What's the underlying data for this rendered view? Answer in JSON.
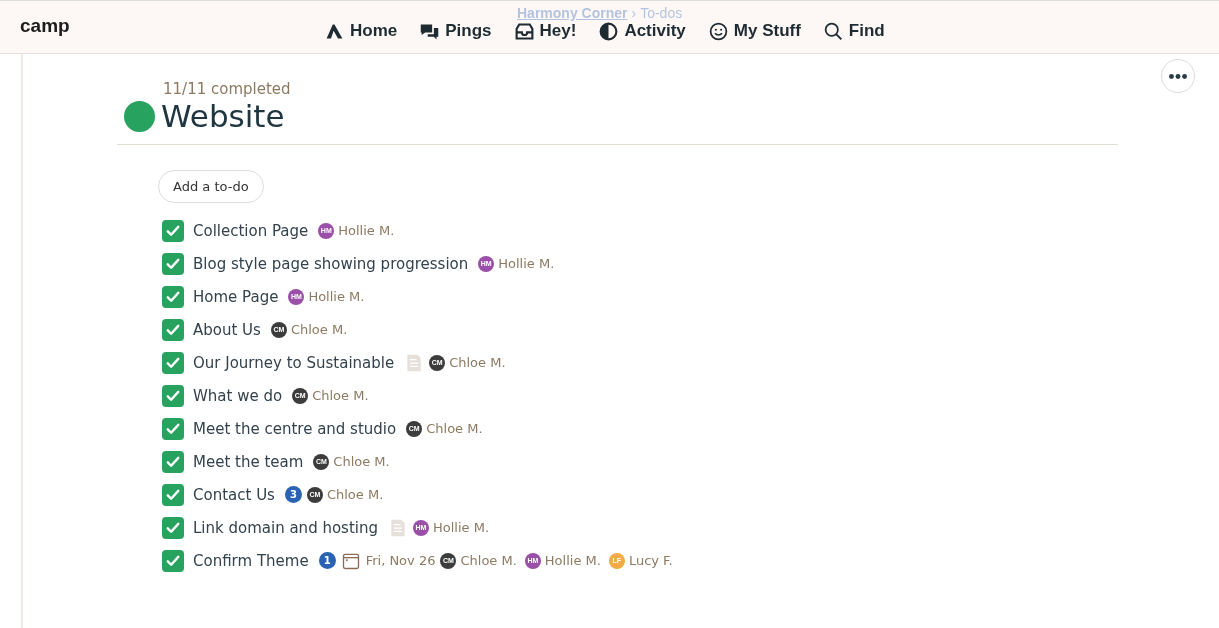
{
  "header": {
    "brand": "camp",
    "breadcrumb": {
      "project": "Harmony Corner",
      "separator": "›",
      "section": "To-dos"
    },
    "nav": [
      {
        "kind": "home",
        "label": "Home"
      },
      {
        "kind": "pings",
        "label": "Pings"
      },
      {
        "kind": "hey",
        "label": "Hey!"
      },
      {
        "kind": "activity",
        "label": "Activity"
      },
      {
        "kind": "stuff",
        "label": "My Stuff"
      },
      {
        "kind": "find",
        "label": "Find"
      }
    ]
  },
  "list": {
    "progress": "11/11 completed",
    "title": "Website",
    "add_button": "Add a to-do",
    "todos": [
      {
        "title": "Collection Page",
        "checked": true,
        "meta": [
          {
            "kind": "assignee",
            "initials": "HM",
            "name": "Hollie M.",
            "color": "#9a50a9"
          }
        ]
      },
      {
        "title": "Blog style page showing progression",
        "checked": true,
        "meta": [
          {
            "kind": "assignee",
            "initials": "HM",
            "name": "Hollie M.",
            "color": "#9a50a9"
          }
        ]
      },
      {
        "title": "Home Page",
        "checked": true,
        "meta": [
          {
            "kind": "assignee",
            "initials": "HM",
            "name": "Hollie M.",
            "color": "#9a50a9"
          }
        ]
      },
      {
        "title": "About Us",
        "checked": true,
        "meta": [
          {
            "kind": "assignee",
            "initials": "CM",
            "name": "Chloe M.",
            "color": "#3c3c3c"
          }
        ]
      },
      {
        "title": "Our Journey to Sustainable",
        "checked": true,
        "meta": [
          {
            "kind": "note"
          },
          {
            "kind": "assignee",
            "initials": "CM",
            "name": "Chloe M.",
            "color": "#3c3c3c"
          }
        ]
      },
      {
        "title": "What we do",
        "checked": true,
        "meta": [
          {
            "kind": "assignee",
            "initials": "CM",
            "name": "Chloe M.",
            "color": "#3c3c3c"
          }
        ]
      },
      {
        "title": "Meet the centre and studio",
        "checked": true,
        "meta": [
          {
            "kind": "assignee",
            "initials": "CM",
            "name": "Chloe M.",
            "color": "#3c3c3c"
          }
        ]
      },
      {
        "title": "Meet the team",
        "checked": true,
        "meta": [
          {
            "kind": "assignee",
            "initials": "CM",
            "name": "Chloe M.",
            "color": "#3c3c3c"
          }
        ]
      },
      {
        "title": "Contact Us",
        "checked": true,
        "meta": [
          {
            "kind": "comments",
            "count": "3"
          },
          {
            "kind": "assignee",
            "initials": "CM",
            "name": "Chloe M.",
            "color": "#3c3c3c"
          }
        ]
      },
      {
        "title": "Link domain and hosting",
        "checked": true,
        "meta": [
          {
            "kind": "note"
          },
          {
            "kind": "assignee",
            "initials": "HM",
            "name": "Hollie M.",
            "color": "#9a50a9"
          }
        ]
      },
      {
        "title": "Confirm Theme",
        "checked": true,
        "meta": [
          {
            "kind": "comments",
            "count": "1"
          },
          {
            "kind": "date",
            "text": "Fri, Nov 26"
          },
          {
            "kind": "assignee",
            "initials": "CM",
            "name": "Chloe M.",
            "color": "#3c3c3c"
          },
          {
            "kind": "assignee",
            "initials": "HM",
            "name": "Hollie M.",
            "color": "#9a50a9"
          },
          {
            "kind": "assignee",
            "initials": "LF",
            "name": "Lucy F.",
            "color": "#f4aa45"
          }
        ]
      }
    ]
  }
}
